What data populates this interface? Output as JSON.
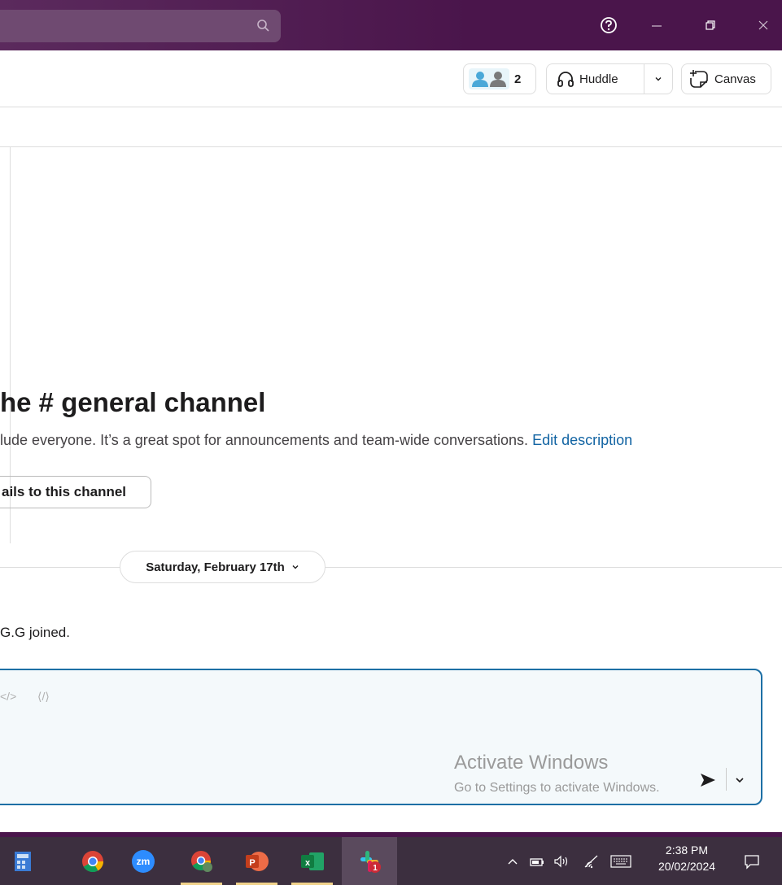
{
  "titlebar": {
    "search_icon": "search-icon",
    "help_icon": "help-circle-icon",
    "minimize_icon": "minimize-icon",
    "restore_icon": "restore-icon",
    "close_icon": "close-icon"
  },
  "header": {
    "member_count": "2",
    "huddle_label": "Huddle",
    "canvas_label": "Canvas"
  },
  "intro": {
    "title_prefix": "he # general channel",
    "description": "lude everyone. It’s a great spot for announcements and team-wide conversations.",
    "edit_link": "Edit description",
    "emails_button": "ails to this channel"
  },
  "date_divider": {
    "label": "Saturday, February 17th"
  },
  "messages": [
    {
      "text": "G.G joined."
    }
  ],
  "composer": {
    "format_code": "</>",
    "format_codeblock": "⟨/⟩"
  },
  "watermark": {
    "line1": "Activate Windows",
    "line2": "Go to Settings to activate Windows."
  },
  "taskbar": {
    "apps": [
      "calculator-icon",
      "chrome-icon",
      "zoom-icon",
      "chrome-profile-icon",
      "powerpoint-icon",
      "excel-icon",
      "slack-icon"
    ],
    "zoom_label": "zm",
    "time": "2:38 PM",
    "date": "20/02/2024",
    "slack_badge": "1"
  },
  "colors": {
    "titlebar": "#4a154b",
    "accent_link": "#1264a3",
    "composer_border": "#1d6fa5",
    "taskbar": "#3c2f3f"
  }
}
